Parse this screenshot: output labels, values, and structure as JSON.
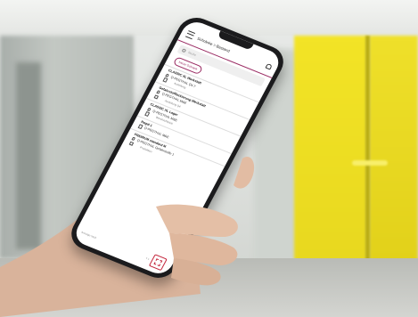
{
  "app": {
    "title": "Schränke > Bestand",
    "search_placeholder": "Suche",
    "new_button_label": "Neuer Schrank",
    "accent_color": "#9a2b63",
    "items": [
      {
        "title": "CLASSIC XL Werkstatt",
        "model": "Q-PEGTHAL Q4 7",
        "sub": "Ausleitung"
      },
      {
        "title": "Gefahrstofflackierung Werkstatt",
        "model": "Q-PEGTHAL M&E",
        "sub": "Ausleitung Q4"
      },
      {
        "title": "CLASSIC XL Lager",
        "model": "Q-PEGTHAL M&E",
        "sub": "Wandsichtlokal"
      },
      {
        "title": "Regal 1",
        "model": "Q-PEGTHAL M&E",
        "sub": ""
      },
      {
        "title": "PREMIUM standard M",
        "model": "Q-PEGTHAL Gefahrstoffe 1",
        "sub": "Produktion"
      }
    ],
    "footer_text": "Anzeige nach",
    "nav_arrows": "‹ ›"
  },
  "colors": {
    "yellow_cabinet": "#f0e024",
    "phone_body": "#1b1b1d",
    "qr_accent": "#c4243b"
  }
}
